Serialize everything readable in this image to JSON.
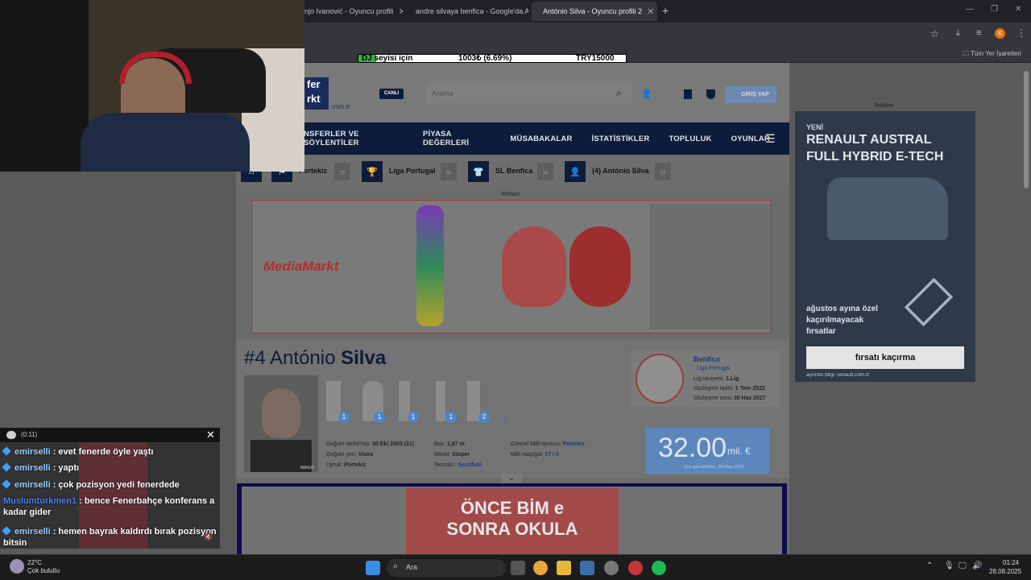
{
  "browser": {
    "tabs": [
      {
        "title": "njo Ivanović - Oyuncu profili"
      },
      {
        "title": "andre silvaya benfica - Google'da Ara"
      },
      {
        "title": "António Silva - Oyuncu profili 2"
      }
    ],
    "new_tab": "+",
    "bookmarks_label": "Tüm Yer İşaretleri",
    "profile_letter": "K"
  },
  "stream_bar": {
    "label": "DJ seyisi için",
    "value": "1003₺ (6.69%)",
    "goal": "TRY15000"
  },
  "site": {
    "logo_top": "fer",
    "logo_bottom": "rkt",
    "logo_domain": ".com.tr",
    "live": "CANLI",
    "search_placeholder": "Arama",
    "login": "GİRİŞ YAP",
    "nav": [
      "NSFERLER VE SÖYLENTİLER",
      "PİYASA DEĞERLERİ",
      "MÜSABAKALAR",
      "İSTATİSTİKLER",
      "TOPLULUK",
      "OYUNLAR"
    ],
    "breadcrumbs": [
      "Portekiz",
      "Liga Portugal",
      "SL Benfica",
      "(4) António Silva"
    ],
    "ad_label": "Reklam",
    "ad_brand": "MediaMarkt"
  },
  "profile": {
    "number": "#4",
    "first": "António",
    "last": "Silva",
    "trophy_counts": [
      "1",
      "1",
      "1",
      "1",
      "2"
    ],
    "photo_credit": "IMAGO",
    "club": "Benfica",
    "league": "Liga Portugal",
    "league_level_label": "Lig seviyesi:",
    "league_level": "1.Lig",
    "joined_label": "Sözleşme tarihi:",
    "joined": "1 Tem 2022",
    "contract_label": "Sözleşme sonu",
    "contract": "30 Haz 2027",
    "details": [
      {
        "label": "Doğum tarihi/Yaş:",
        "value": "30 Eki 2003 (21)"
      },
      {
        "label": "Doğum yeri:",
        "value": "Viseu"
      },
      {
        "label": "Uyruk:",
        "value": "Portekiz"
      },
      {
        "label": "Boy:",
        "value": "1,87 m"
      },
      {
        "label": "Mevki:",
        "value": "Stoper"
      },
      {
        "label": "Temsilci:",
        "value": "Gestifute"
      },
      {
        "label": "Güncel Milli oyuncu:",
        "value": "Portekiz"
      },
      {
        "label": "Milli maç/gol:",
        "value": "17 / 0"
      }
    ],
    "market_value": "32.00",
    "market_unit": "mil. €",
    "market_updated": "Son güncelleme: 30 May 2025"
  },
  "bottom_ad": {
    "line1": "ÖNCE BİM e",
    "line2": "SONRA OKULA"
  },
  "side_ad": {
    "label": "Reklam",
    "new": "YENİ",
    "title1": "RENAULT AUSTRAL",
    "title2": "FULL HYBRID E-TECH",
    "promo1": "ağustos ayına özel",
    "promo2": "kaçırılmayacak",
    "promo3": "fırsatlar",
    "cta": "fırsatı kaçırma",
    "footer": "ayrıntılı bilgi: renault.com.tr"
  },
  "chat": {
    "timer": "(0:11)",
    "messages": [
      {
        "user": "emirselli",
        "text": ": evet fenerde öyle yaştı"
      },
      {
        "user": "emirselli",
        "text": ": yaptı"
      },
      {
        "user": "emirselli",
        "text": ": çok pozisyon yedi fenerdede"
      },
      {
        "user": "Muslumturkmen1",
        "text": ": bence Fenerbahçe konferans a kadar gider"
      },
      {
        "user": "emirselli",
        "text": ": hemen bayrak kaldırdı bırak pozisyon bitsin"
      }
    ]
  },
  "taskbar": {
    "temp": "22°C",
    "weather": "Çok bulutlu",
    "search": "Ara",
    "time": "01:24",
    "date": "28.08.2025"
  }
}
